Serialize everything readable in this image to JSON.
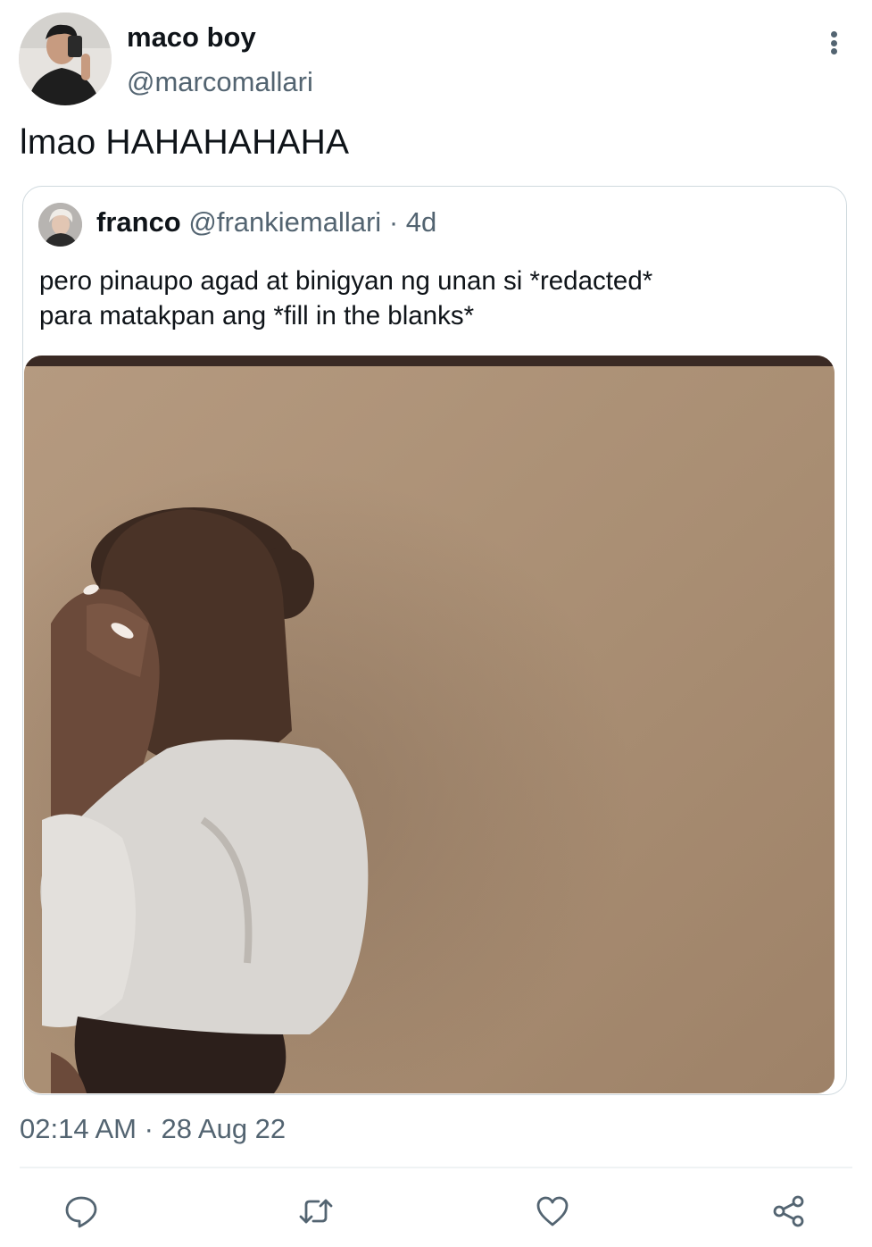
{
  "author": {
    "display_name": "maco boy",
    "handle": "@marcomallari"
  },
  "tweet": {
    "text": "lmao HAHAHAHAHA",
    "timestamp": "02:14 AM · 28 Aug 22"
  },
  "quoted_tweet": {
    "display_name": "franco",
    "handle": "@frankiemallari",
    "separator": "·",
    "age": "4d",
    "text_lines": [
      "pero pinaupo agad at binigyan ng unan si *redacted*",
      "para matakpan ang *fill in the blanks*"
    ]
  },
  "icons": {
    "more": "more-vertical-icon",
    "reply": "reply-icon",
    "retweet": "retweet-icon",
    "like": "heart-icon",
    "share": "share-icon"
  },
  "colors": {
    "text_primary": "#0f1419",
    "text_secondary": "#536471",
    "border": "#cfd9de",
    "icon": "#536471"
  }
}
